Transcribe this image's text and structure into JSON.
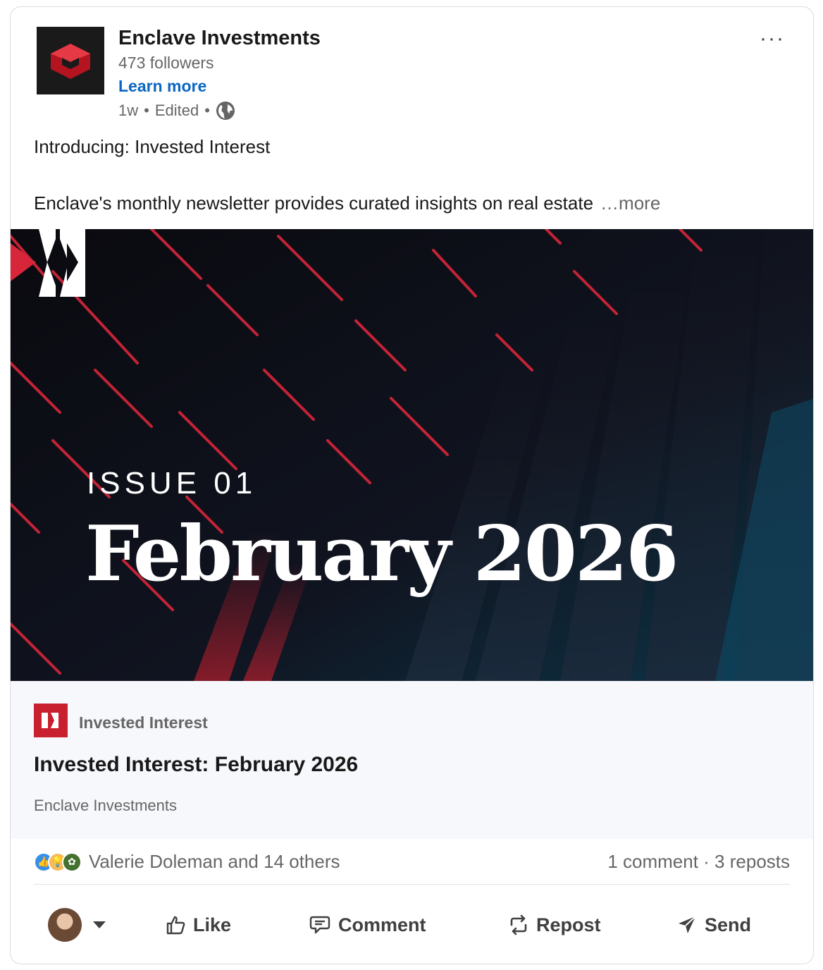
{
  "post": {
    "company": "Enclave Investments",
    "followers": "473 followers",
    "learn_more": "Learn more",
    "time": "1w",
    "edited": "Edited",
    "separator": "•",
    "more_menu": "···",
    "intro": "Introducing: Invested Interest",
    "body": "Enclave's monthly newsletter provides curated insights on real estate",
    "see_more": "…more"
  },
  "hero": {
    "issue": "ISSUE 01",
    "title": "February 2026"
  },
  "newsletter": {
    "name": "Invested Interest",
    "title": "Invested Interest: February 2026",
    "author": "Enclave Investments"
  },
  "social": {
    "reactions_text": "Valerie Doleman and 14 others",
    "counts_text": "1 comment · 3 reposts",
    "reaction_icons": [
      "like-icon",
      "insightful-icon",
      "support-icon"
    ]
  },
  "actions": {
    "like": "Like",
    "comment": "Comment",
    "repost": "Repost",
    "send": "Send"
  },
  "colors": {
    "brand_red": "#c8202f",
    "link_blue": "#0a66c2",
    "text_muted": "#666666"
  }
}
